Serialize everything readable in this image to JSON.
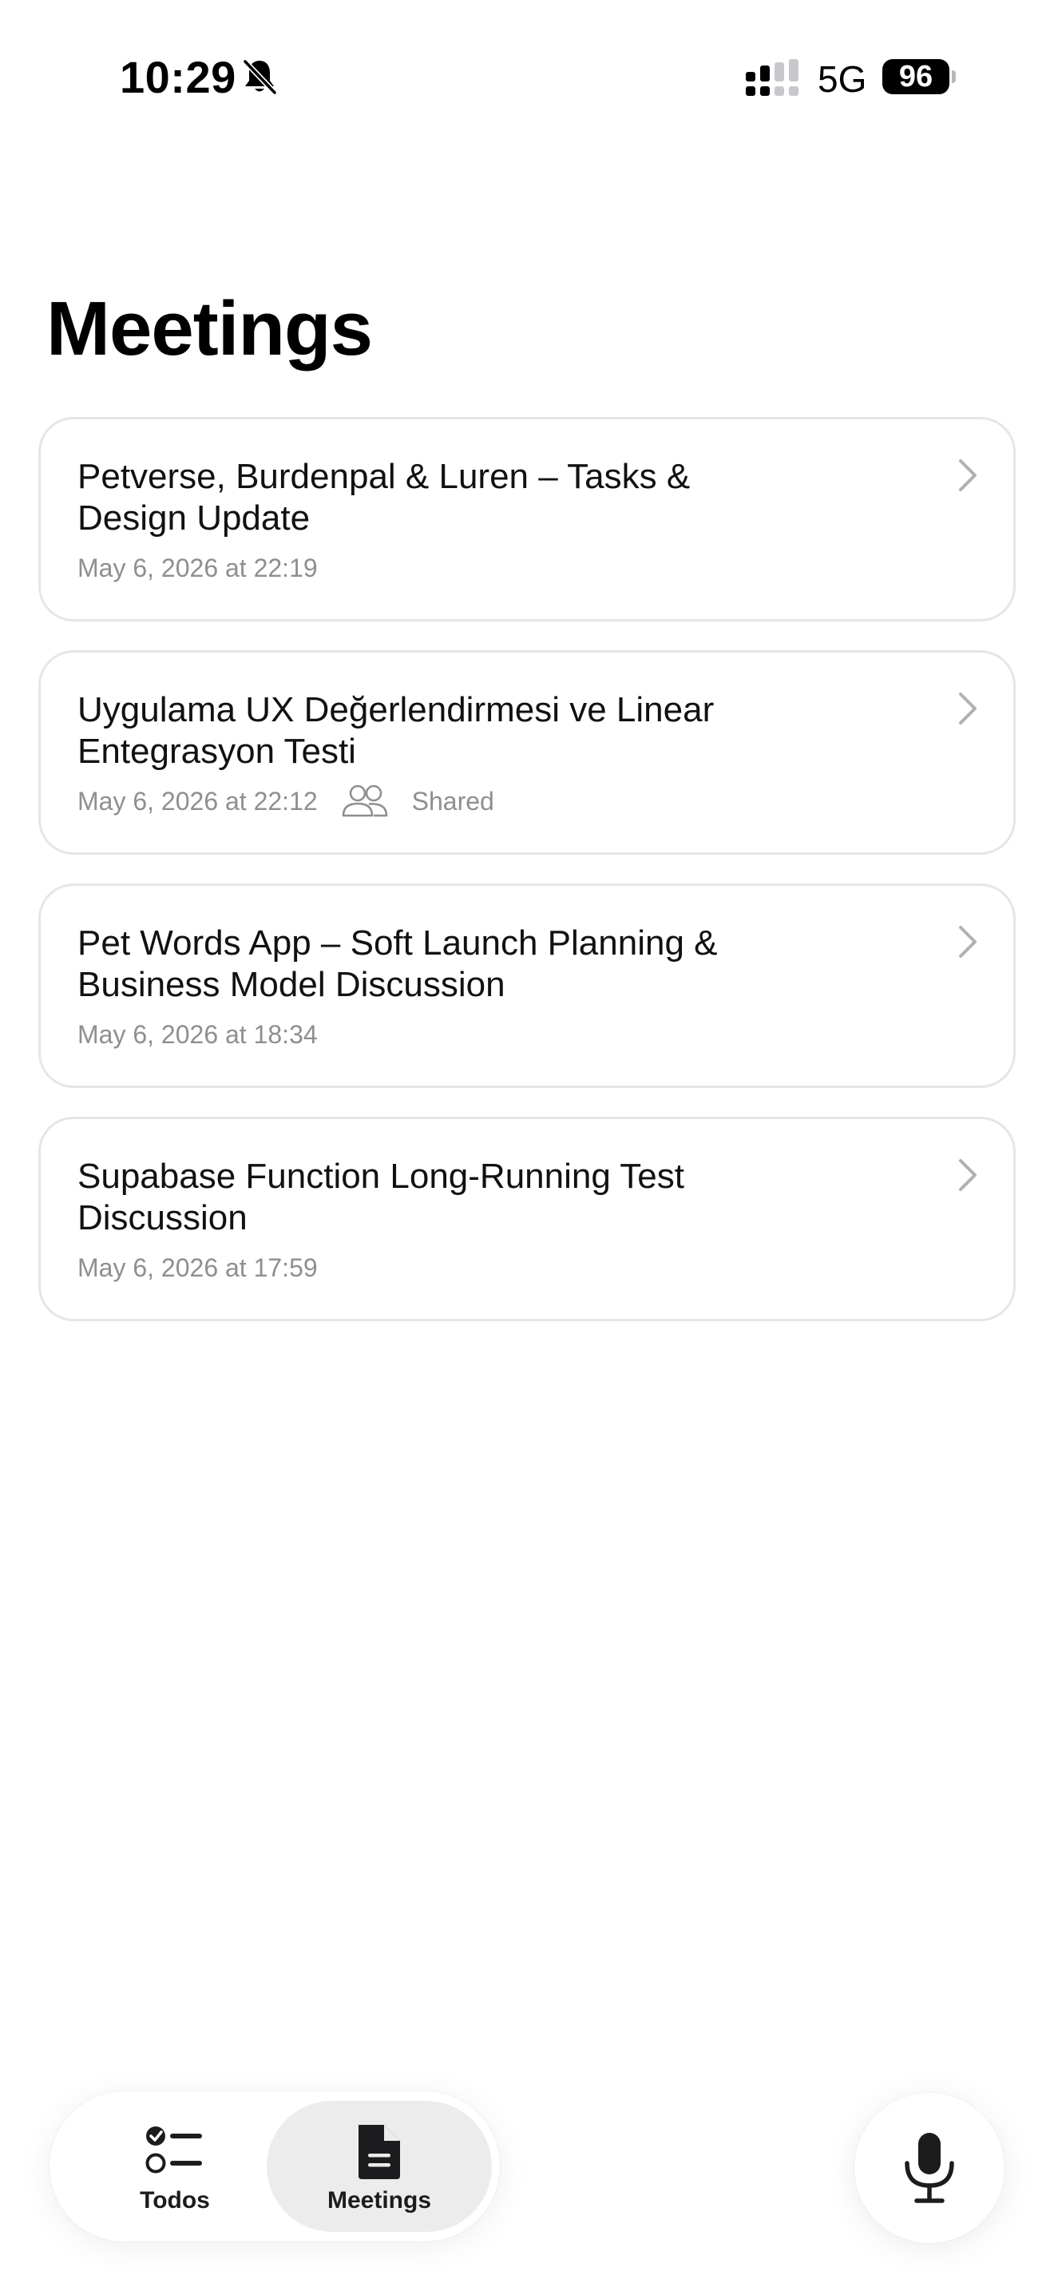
{
  "status_bar": {
    "time": "10:29",
    "network": "5G",
    "battery": "96",
    "icons": [
      "bell-slash-icon",
      "cellular-signal-icon"
    ]
  },
  "page": {
    "title": "Meetings"
  },
  "meetings": [
    {
      "title": "Petverse, Burdenpal & Luren – Tasks & Design Update",
      "date": "May 6, 2026 at 22:19",
      "shared": ""
    },
    {
      "title": "Uygulama UX Değerlendirmesi ve Linear Entegrasyon Testi",
      "date": "May 6, 2026 at 22:12",
      "shared": "Shared"
    },
    {
      "title": "Pet Words App – Soft Launch Planning & Business Model Discussion",
      "date": "May 6, 2026 at 18:34",
      "shared": ""
    },
    {
      "title": "Supabase Function Long-Running Test Discussion",
      "date": "May 6, 2026 at 17:59",
      "shared": ""
    }
  ],
  "tab_bar": {
    "todos_label": "Todos",
    "meetings_label": "Meetings",
    "active": "Meetings"
  },
  "colors": {
    "secondary_text": "#8e8e93",
    "card_border": "#e6e6e6",
    "active_tab_bg": "#ececec"
  }
}
